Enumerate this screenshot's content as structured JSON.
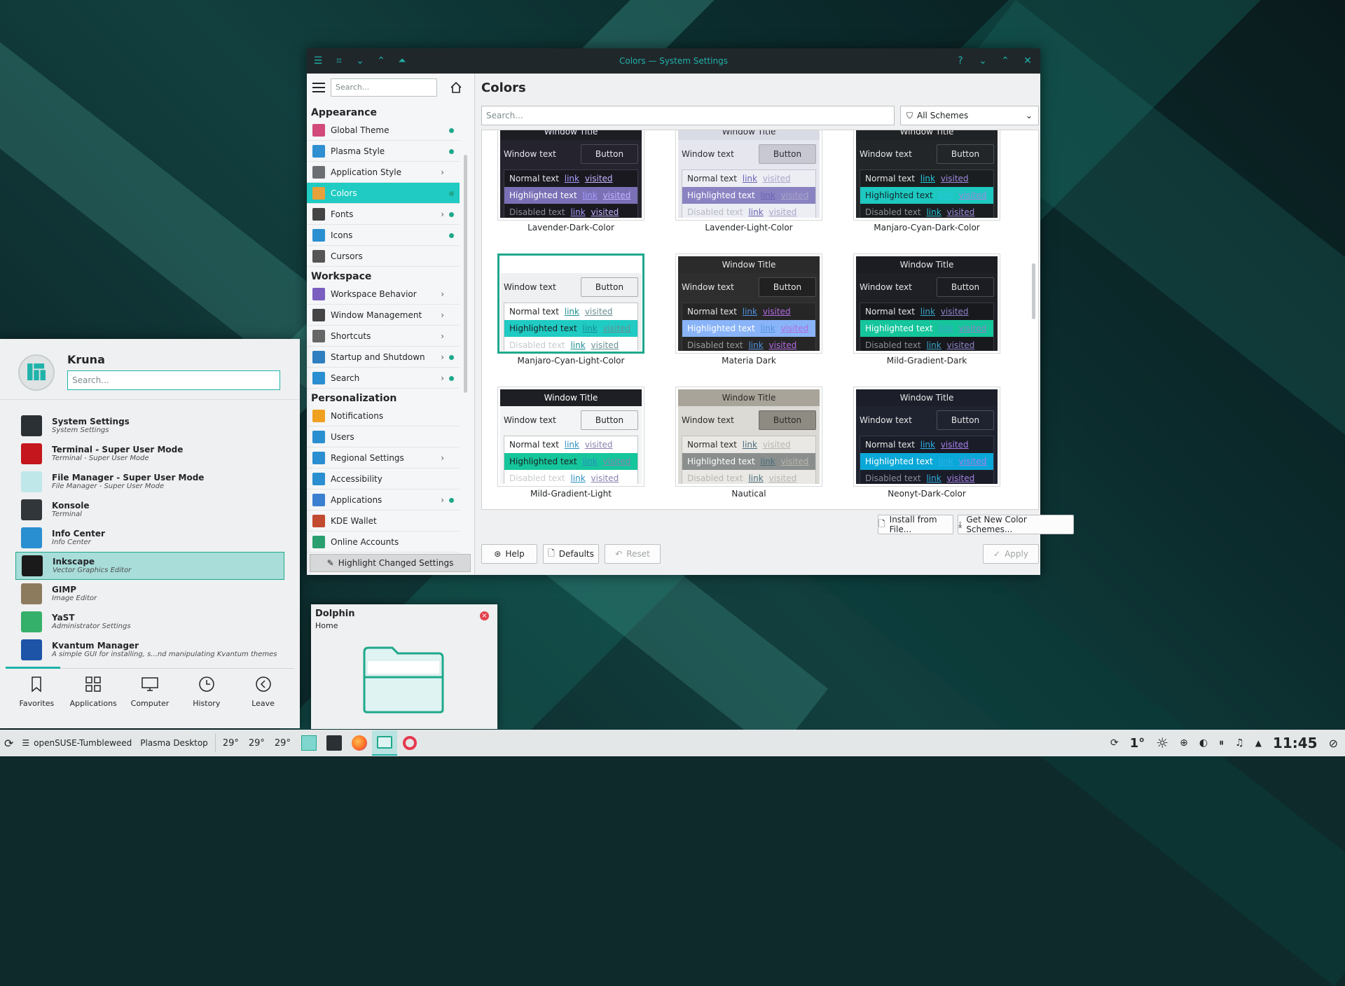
{
  "window": {
    "title": "Colors — System Settings",
    "sidebar": {
      "search_placeholder": "Search...",
      "categories": [
        {
          "label": "Appearance",
          "items": [
            {
              "label": "Global Theme",
              "arrow": false,
              "dot": true
            },
            {
              "label": "Plasma Style",
              "arrow": false,
              "dot": true
            },
            {
              "label": "Application Style",
              "arrow": true,
              "dot": false
            },
            {
              "label": "Colors",
              "arrow": false,
              "dot": true,
              "active": true
            },
            {
              "label": "Fonts",
              "arrow": true,
              "dot": true
            },
            {
              "label": "Icons",
              "arrow": false,
              "dot": true
            },
            {
              "label": "Cursors",
              "arrow": false,
              "dot": false
            }
          ]
        },
        {
          "label": "Workspace",
          "items": [
            {
              "label": "Workspace Behavior",
              "arrow": true,
              "dot": false
            },
            {
              "label": "Window Management",
              "arrow": true,
              "dot": false
            },
            {
              "label": "Shortcuts",
              "arrow": true,
              "dot": false
            },
            {
              "label": "Startup and Shutdown",
              "arrow": true,
              "dot": true
            },
            {
              "label": "Search",
              "arrow": true,
              "dot": true
            }
          ]
        },
        {
          "label": "Personalization",
          "items": [
            {
              "label": "Notifications",
              "arrow": false,
              "dot": false
            },
            {
              "label": "Users",
              "arrow": false,
              "dot": false
            },
            {
              "label": "Regional Settings",
              "arrow": true,
              "dot": false
            },
            {
              "label": "Accessibility",
              "arrow": false,
              "dot": false
            },
            {
              "label": "Applications",
              "arrow": true,
              "dot": true
            },
            {
              "label": "KDE Wallet",
              "arrow": false,
              "dot": false
            },
            {
              "label": "Online Accounts",
              "arrow": false,
              "dot": false
            }
          ]
        }
      ],
      "highlight_button": "Highlight Changed Settings"
    },
    "main": {
      "title": "Colors",
      "search_placeholder": "Search...",
      "filter_label": "All Schemes",
      "preview_text": {
        "window_title": "Window Title",
        "window_text": "Window text",
        "button": "Button",
        "normal": "Normal text",
        "highlighted": "Highlighted text",
        "disabled": "Disabled text",
        "link": "link",
        "visited": "visited"
      },
      "schemes": [
        {
          "name": "Lavender-Dark-Color",
          "title_bg": "#1d1d24",
          "title_fg": "#e6e6f0",
          "win_bg": "#24232e",
          "win_fg": "#e6e6f0",
          "btn_bg": "#24232e",
          "btn_fg": "#e6e6f0",
          "btn_border": "#4a4a58",
          "view_bg": "#1a1920",
          "view_fg": "#e6e6f0",
          "hl_bg": "#7a70b6",
          "hl_fg": "#ffffff",
          "link": "#a79eff",
          "visited": "#c5b5ff",
          "dis_fg": "#8c8a97",
          "box_border": "#3d3c48"
        },
        {
          "name": "Lavender-Light-Color",
          "title_bg": "#d9dbe4",
          "title_fg": "#2c2c33",
          "win_bg": "#e6e7ee",
          "win_fg": "#2c2c33",
          "btn_bg": "#c7c8d1",
          "btn_fg": "#2c2c33",
          "btn_border": "#a9aab4",
          "view_bg": "#eceef4",
          "view_fg": "#2c2c33",
          "hl_bg": "#8a83c2",
          "hl_fg": "#ffffff",
          "link": "#6a62b2",
          "visited": "#a9a6c9",
          "dis_fg": "#b8bac4",
          "box_border": "#c3c5cf"
        },
        {
          "name": "Manjaro-Cyan-Dark-Color",
          "title_bg": "#1f2326",
          "title_fg": "#e6e6e6",
          "win_bg": "#222629",
          "win_fg": "#e6e6e6",
          "btn_bg": "#222629",
          "btn_fg": "#e6e6e6",
          "btn_border": "#4a5054",
          "view_bg": "#1b1e20",
          "view_fg": "#e6e6e6",
          "hl_bg": "#1ec8c0",
          "hl_fg": "#10252a",
          "link": "#26c6da",
          "visited": "#9e8adc",
          "dis_fg": "#8a9093",
          "box_border": "#3a4044"
        },
        {
          "name": "Manjaro-Cyan-Light-Color",
          "title_bg": "#ffffff",
          "title_fg": "#ffffff",
          "win_bg": "#eff0f1",
          "win_fg": "#232629",
          "btn_bg": "#eff0f1",
          "btn_fg": "#232629",
          "btn_border": "#a8acae",
          "view_bg": "#ffffff",
          "view_fg": "#232629",
          "hl_bg": "#1fcbc2",
          "hl_fg": "#1c2024",
          "link": "#1a8d93",
          "visited": "#6a8e94",
          "dis_fg": "#c6c9cb",
          "box_border": "#c0c4c6",
          "selected": true
        },
        {
          "name": "Materia Dark",
          "title_bg": "#2b2b2b",
          "title_fg": "#e6e6e6",
          "win_bg": "#2e2e2e",
          "win_fg": "#e6e6e6",
          "btn_bg": "#212121",
          "btn_fg": "#e6e6e6",
          "btn_border": "#4d4d4d",
          "view_bg": "#262626",
          "view_fg": "#e6e6e6",
          "hl_bg": "#8ab4f8",
          "hl_fg": "#ffffff",
          "link": "#5294e2",
          "visited": "#b26be0",
          "dis_fg": "#9a9a9a",
          "box_border": "#3a3a3a"
        },
        {
          "name": "Mild-Gradient-Dark",
          "title_bg": "#1b1d22",
          "title_fg": "#e6e6e6",
          "win_bg": "#1e2026",
          "win_fg": "#e6e6e6",
          "btn_bg": "#1b1d22",
          "btn_fg": "#e6e6e6",
          "btn_border": "#4a4d55",
          "view_bg": "#17191d",
          "view_fg": "#e6e6e6",
          "hl_bg": "#15c59b",
          "hl_fg": "#ffffff",
          "link": "#3aa5c8",
          "visited": "#8f82c9",
          "dis_fg": "#8a8d93",
          "box_border": "#363940"
        },
        {
          "name": "Mild-Gradient-Light",
          "title_bg": "#1d1f24",
          "title_fg": "#ffffff",
          "win_bg": "#f3f4f5",
          "win_fg": "#232629",
          "btn_bg": "#f3f4f5",
          "btn_fg": "#232629",
          "btn_border": "#a8acae",
          "view_bg": "#ffffff",
          "view_fg": "#232629",
          "hl_bg": "#15c59b",
          "hl_fg": "#1c2024",
          "link": "#2a8fbf",
          "visited": "#8a7fb0",
          "dis_fg": "#c9cccd",
          "box_border": "#c0c4c6"
        },
        {
          "name": "Nautical",
          "title_bg": "#a8a49a",
          "title_fg": "#2c2a25",
          "win_bg": "#dcdad5",
          "win_fg": "#2c2a25",
          "btn_bg": "#8e8b83",
          "btn_fg": "#2c2a25",
          "btn_border": "#6d6a63",
          "view_bg": "#e9e8e4",
          "view_fg": "#2c2a25",
          "hl_bg": "#8a8f8e",
          "hl_fg": "#ffffff",
          "link": "#4a6b7c",
          "visited": "#b9b6ae",
          "dis_fg": "#b9b6ae",
          "box_border": "#c2bfb8"
        },
        {
          "name": "Neonyt-Dark-Color",
          "title_bg": "#1c1f2a",
          "title_fg": "#e6e6e6",
          "win_bg": "#1f2330",
          "win_fg": "#e6e6e6",
          "btn_bg": "#1f2330",
          "btn_fg": "#e6e6e6",
          "btn_border": "#4a5060",
          "view_bg": "#1a1d28",
          "view_fg": "#e6e6e6",
          "hl_bg": "#0aa8d8",
          "hl_fg": "#ffffff",
          "link": "#2ab0e6",
          "visited": "#a580e6",
          "dis_fg": "#8a8e9a",
          "box_border": "#363b4a"
        }
      ],
      "install_button": "Install from File...",
      "get_new_button": "Get New Color Schemes...",
      "help_button": "Help",
      "defaults_button": "Defaults",
      "reset_button": "Reset",
      "apply_button": "Apply"
    }
  },
  "launcher": {
    "user": "Kruna",
    "search_placeholder": "Search...",
    "items": [
      {
        "name": "System Settings",
        "desc": "System Settings",
        "color": "#2b3035"
      },
      {
        "name": "Terminal - Super User Mode",
        "desc": "Terminal - Super User Mode",
        "color": "#c4161c"
      },
      {
        "name": "File Manager - Super User Mode",
        "desc": "File Manager - Super User Mode",
        "color": "#bfe7ea"
      },
      {
        "name": "Konsole",
        "desc": "Terminal",
        "color": "#31363b"
      },
      {
        "name": "Info Center",
        "desc": "Info Center",
        "color": "#2a8fd0"
      },
      {
        "name": "Inkscape",
        "desc": "Vector Graphics Editor",
        "color": "#1a1a1a",
        "highlighted": true
      },
      {
        "name": "GIMP",
        "desc": "Image Editor",
        "color": "#8d7b5d"
      },
      {
        "name": "YaST",
        "desc": "Administrator Settings",
        "color": "#35b06a"
      },
      {
        "name": "Kvantum Manager",
        "desc": "A simple GUI for installing, s...nd manipulating Kvantum themes",
        "color": "#1d54a8"
      }
    ],
    "tabs": [
      "Favorites",
      "Applications",
      "Computer",
      "History",
      "Leave"
    ]
  },
  "tooltip": {
    "title": "Dolphin",
    "subtitle": "Home"
  },
  "panel": {
    "activity": "openSUSE-Tumbleweed",
    "desktop": "Plasma Desktop",
    "weather": [
      "29°",
      "29°",
      "29°"
    ],
    "tray_temp": "1°",
    "clock": "11:45"
  }
}
